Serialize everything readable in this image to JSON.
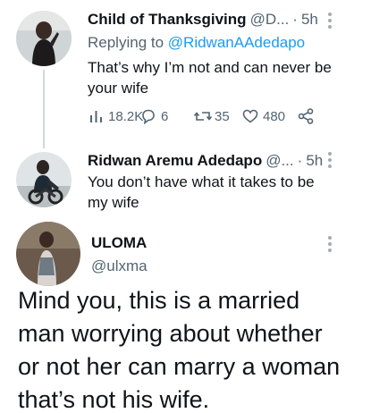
{
  "tweet1": {
    "name": "Child of Thanksgiving",
    "handle": "@D...",
    "separator": "·",
    "time": "5h",
    "reply_prefix": "Replying to ",
    "reply_mention": "@RidwanAAdedapo",
    "text_line1": "That’s why I’m not and can never be",
    "text_line2": "your wife",
    "views": "18.2K",
    "replies": "6",
    "retweets": "35",
    "likes": "480"
  },
  "tweet2": {
    "name": "Ridwan Aremu Adedapo",
    "handle": "@...",
    "separator": "·",
    "time": "5h",
    "text_line1": "You don’t have what it takes to be",
    "text_line2": "my wife"
  },
  "tweet3": {
    "name": "ULOMA",
    "handle": "@ulxma",
    "text_lines": [
      "Mind you, this is a married",
      "man worrying about whether",
      "or not her can marry a woman",
      "that’s not his wife."
    ]
  },
  "icons": {
    "views": "views-icon",
    "reply": "reply-icon",
    "retweet": "retweet-icon",
    "like": "heart-icon",
    "share": "share-icon",
    "more": "more-dots-icon"
  },
  "colors": {
    "link": "#1d9bf0",
    "secondary": "#536471",
    "text": "#0f1419"
  }
}
